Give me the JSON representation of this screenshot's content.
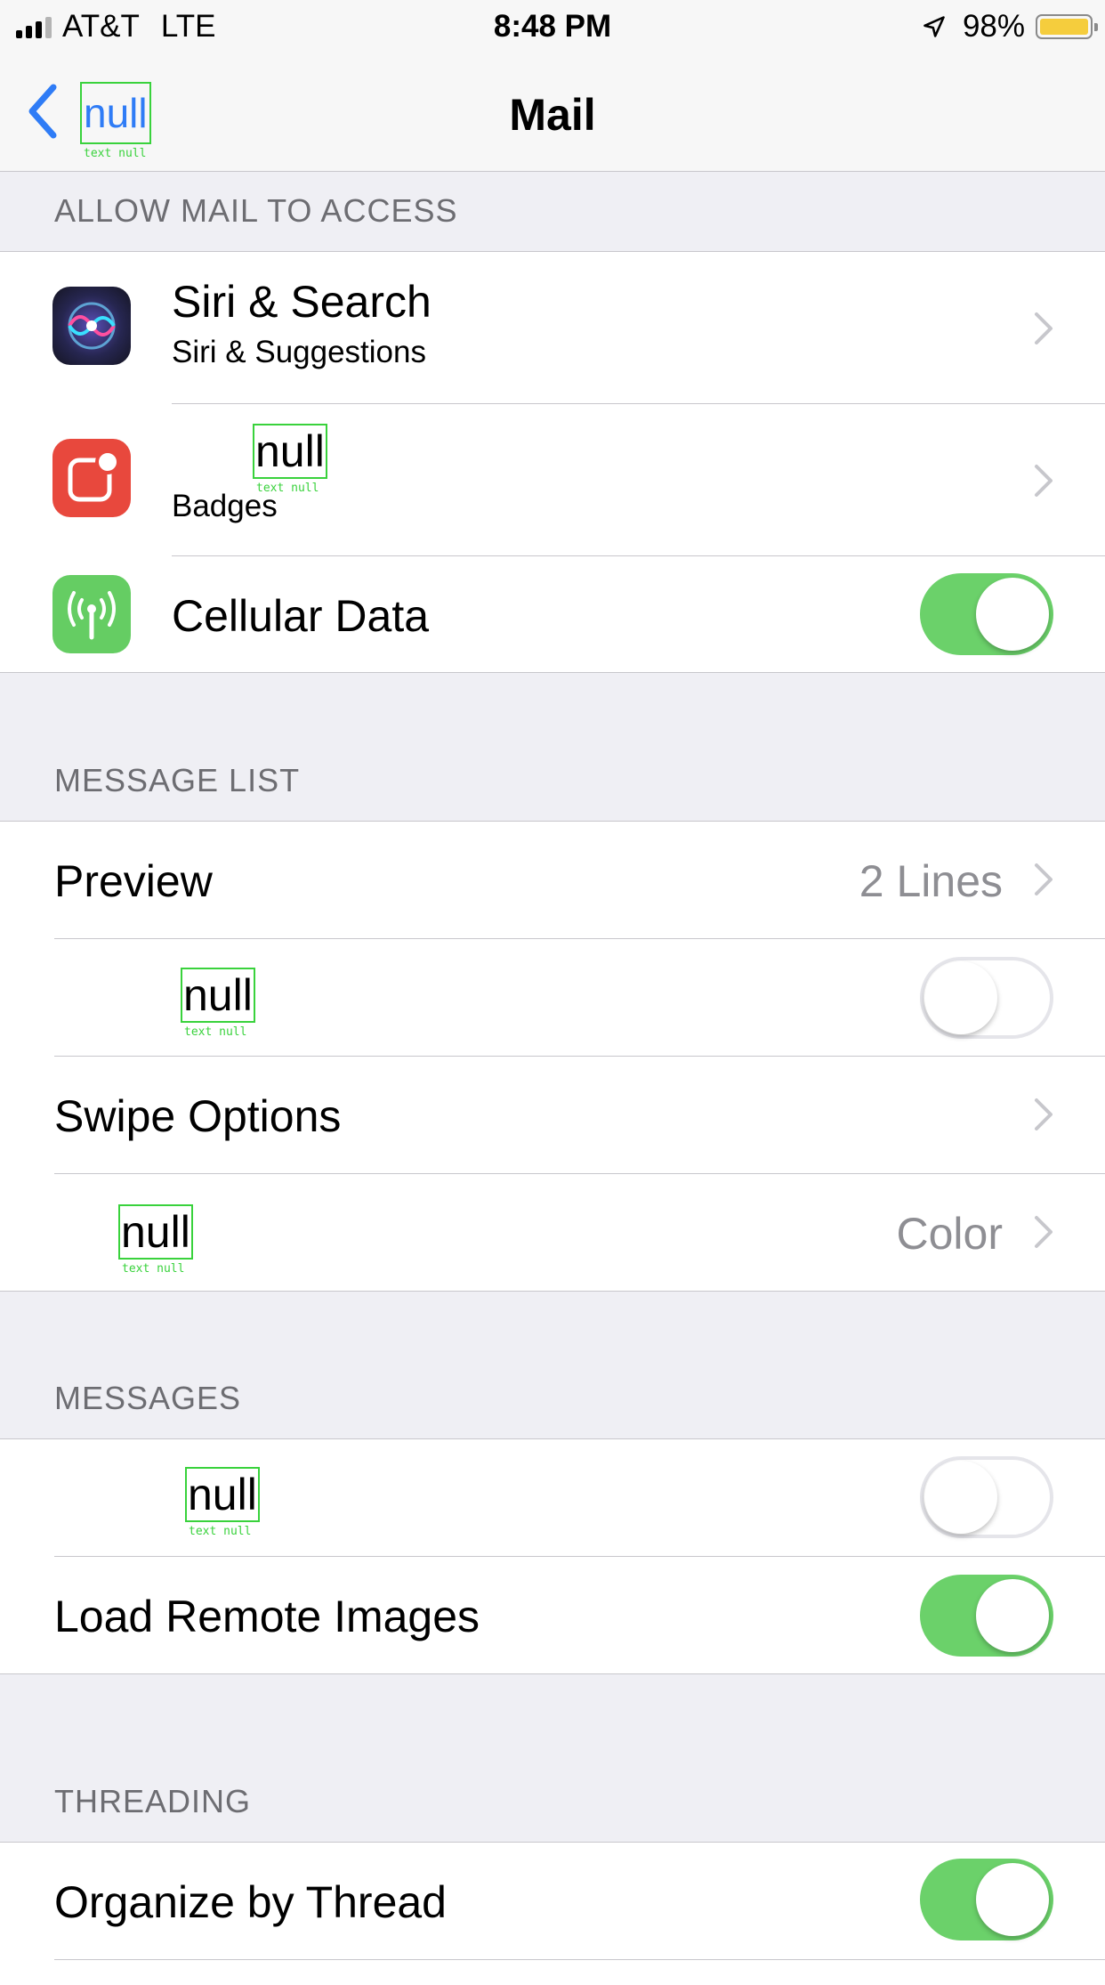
{
  "status_bar": {
    "carrier": "AT&T",
    "network": "LTE",
    "time": "8:48 PM",
    "battery": "98%"
  },
  "nav": {
    "back_label": "null",
    "back_debug": "text null",
    "title": "Mail"
  },
  "sections": {
    "access": {
      "header": "ALLOW MAIL TO ACCESS",
      "siri": {
        "title": "Siri & Search",
        "subtitle": "Siri & Suggestions"
      },
      "notifications": {
        "title": "null",
        "debug": "text null",
        "subtitle": "Badges"
      },
      "cellular": {
        "title": "Cellular Data",
        "on": true
      }
    },
    "message_list": {
      "header": "MESSAGE LIST",
      "preview": {
        "title": "Preview",
        "value": "2 Lines"
      },
      "labels_row": {
        "title": "null",
        "debug": "text null",
        "on": false
      },
      "swipe": {
        "title": "Swipe Options"
      },
      "flag_row": {
        "title": "null",
        "debug": "text null",
        "value": "Color"
      }
    },
    "messages": {
      "header": "MESSAGES",
      "ask_row": {
        "title": "null",
        "debug": "text null",
        "on": false
      },
      "remote_images": {
        "title": "Load Remote Images",
        "on": true
      }
    },
    "threading": {
      "header": "THREADING",
      "organize": {
        "title": "Organize by Thread",
        "on": true
      }
    }
  },
  "colors": {
    "accent": "#2f7cf6",
    "toggle_on": "#6bd16a",
    "debug_box": "#39d23c",
    "background": "#efeff4"
  }
}
